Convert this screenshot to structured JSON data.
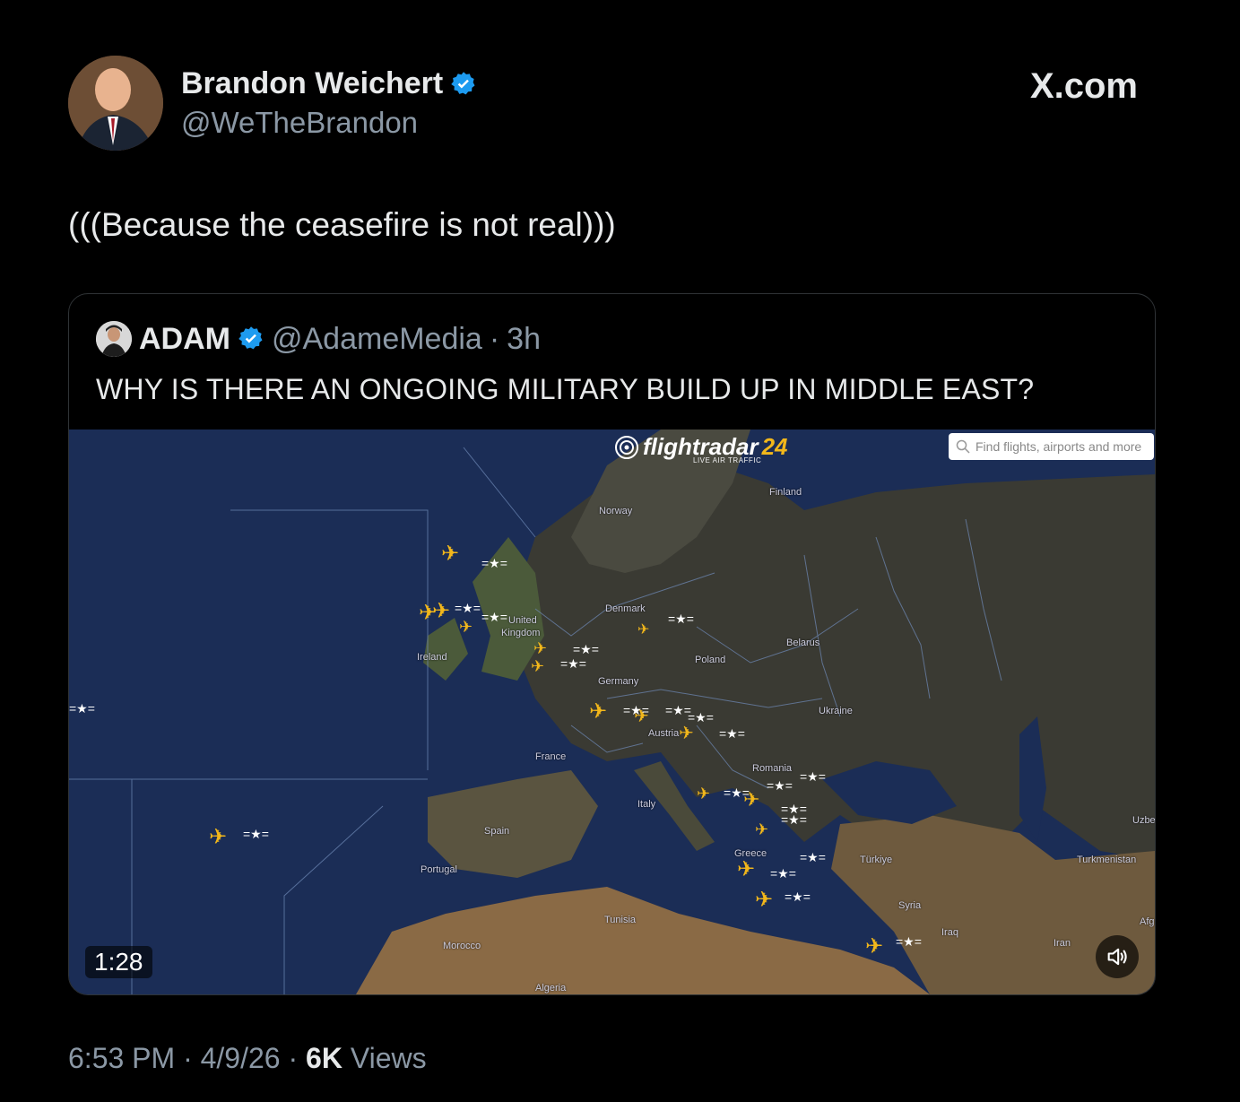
{
  "author": {
    "name": "Brandon Weichert",
    "handle": "@WeTheBrandon",
    "verified": true
  },
  "brand": "X.com",
  "tweet_text": "(((Because the ceasefire is not real)))",
  "quote": {
    "name": "ADAM",
    "handle": "@AdameMedia",
    "separator": "·",
    "time": "3h",
    "text": "WHY IS THERE AN ONGOING MILITARY BUILD UP IN MIDDLE EAST?",
    "video": {
      "duration": "1:28",
      "logo_text": "flightradar",
      "logo_num": "24",
      "logo_sub": "LIVE AIR TRAFFIC",
      "search_placeholder": "Find flights, airports and more",
      "countries": [
        "Norway",
        "Finland",
        "Denmark",
        "United",
        "Kingdom",
        "Ireland",
        "Belarus",
        "Poland",
        "Germany",
        "Ukraine",
        "Austria",
        "France",
        "Romania",
        "Italy",
        "Spain",
        "Portugal",
        "Greece",
        "Türkiye",
        "Turkmenistan",
        "Uzbe",
        "Syria",
        "Iraq",
        "Iran",
        "Afg",
        "Tunisia",
        "Morocco",
        "Algeria"
      ]
    }
  },
  "meta": {
    "time": "6:53 PM",
    "date": "4/9/26",
    "dot": "·",
    "views_count": "6K",
    "views_label": "Views"
  },
  "colors": {
    "verified": "#1d9bf0",
    "plane": "#f2b71b",
    "ocean": "#1a2b52"
  }
}
